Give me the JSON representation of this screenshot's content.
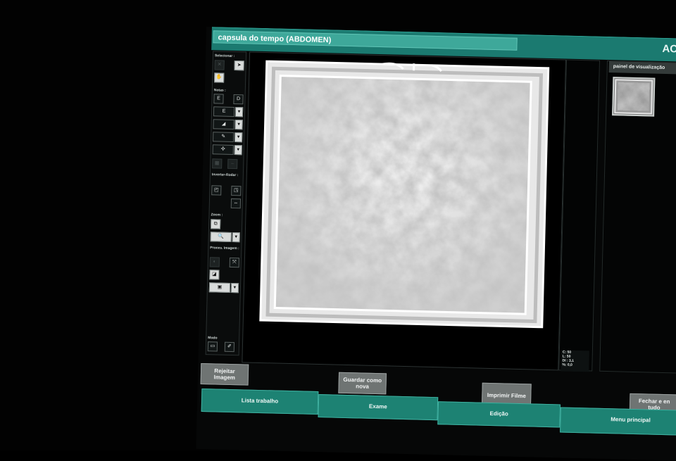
{
  "window": {
    "title": "capsula do tempo (ABDOMEN)",
    "title_right": "AC"
  },
  "tools": {
    "selecionar_label": "Selecionar :",
    "notas_label": "Notas :",
    "nota_e": "E",
    "nota_d": "D",
    "inverter_label": "Inverter-Rodar :",
    "zoom_label": "Zoom :",
    "proces_label": "Proces. Imagem :",
    "modo_label": "Modo"
  },
  "info": {
    "c": "C: 50",
    "l": "L: 50",
    "di": "DI : 3,1",
    "pct": "%: 0,0"
  },
  "thumbnails": {
    "header": "painel de visualização"
  },
  "actions": {
    "rejeitar": "Rejeitar Imagem",
    "guardar": "Guardar como nova",
    "imprimir": "Imprimir Filme",
    "fechar": "Fechar e en tudo"
  },
  "tabs": {
    "lista": "Lista trabalho",
    "exame": "Exame",
    "edicao": "Edição",
    "menu": "Menu principal"
  },
  "colors": {
    "accent": "#1d8273",
    "title_field": "#3ea89a",
    "button": "#6f7473"
  }
}
